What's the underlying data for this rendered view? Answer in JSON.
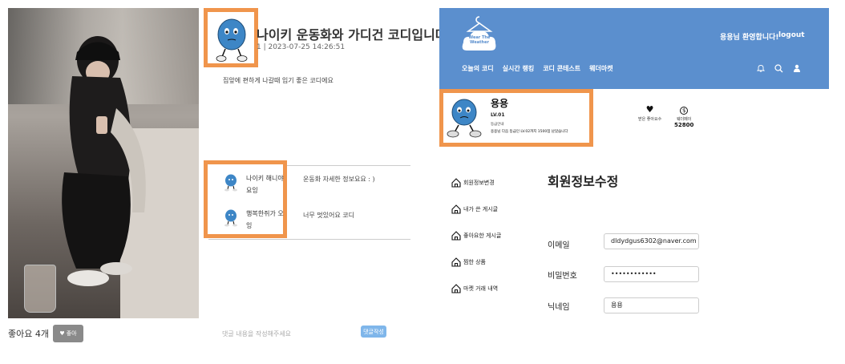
{
  "post": {
    "title": "나이키 운동화와 가디건 코디입니다",
    "meta": "1 | 2023-07-25 14:26:51",
    "body": "집앞에 편하게 나갈때 입기 좋은 코디에요",
    "like_count": "좋아요 4개",
    "like_button": "좋아",
    "comment_placeholder": "댓글 내용을 작성해주세요",
    "comment_submit": "댓글작성"
  },
  "comments": [
    {
      "username": "나이키 해니야 요잉",
      "text": "운동화 자세한 정보요요 : )"
    },
    {
      "username": "행복한쥐가 오잉",
      "text": "너무 멋있어요 코디"
    }
  ],
  "header": {
    "logo_text": "Wear The Weather",
    "welcome": "용용님 환영합니다!",
    "logout": "logout",
    "nav": [
      "오늘의 코디",
      "실시간 랭킹",
      "코디 콘테스트",
      "웨더마켓"
    ]
  },
  "user": {
    "name": "용용",
    "level": "LV.01",
    "grade_label": "등급안내",
    "grade_desc": "용용님 다음 등급인 LV.02까지 1500점 남았습니다",
    "likes_label": "받은 좋아요수",
    "pay_label": "웨더페이",
    "pay_value": "52800"
  },
  "sidebar": [
    "회원정보변경",
    "내가 쓴 게시글",
    "좋아요한 게시글",
    "찜한 상품",
    "마켓 거래 내역"
  ],
  "form": {
    "title": "회원정보수정",
    "email_label": "이메일",
    "email_value": "dldydgus6302@naver.com",
    "password_label": "비밀번호",
    "password_value": "••••••••••••",
    "nickname_label": "닉네임",
    "nickname_value": "용용"
  },
  "colors": {
    "highlight": "#f0954c",
    "header_bg": "#5b8fce",
    "submit_btn": "#7fb6ea"
  }
}
